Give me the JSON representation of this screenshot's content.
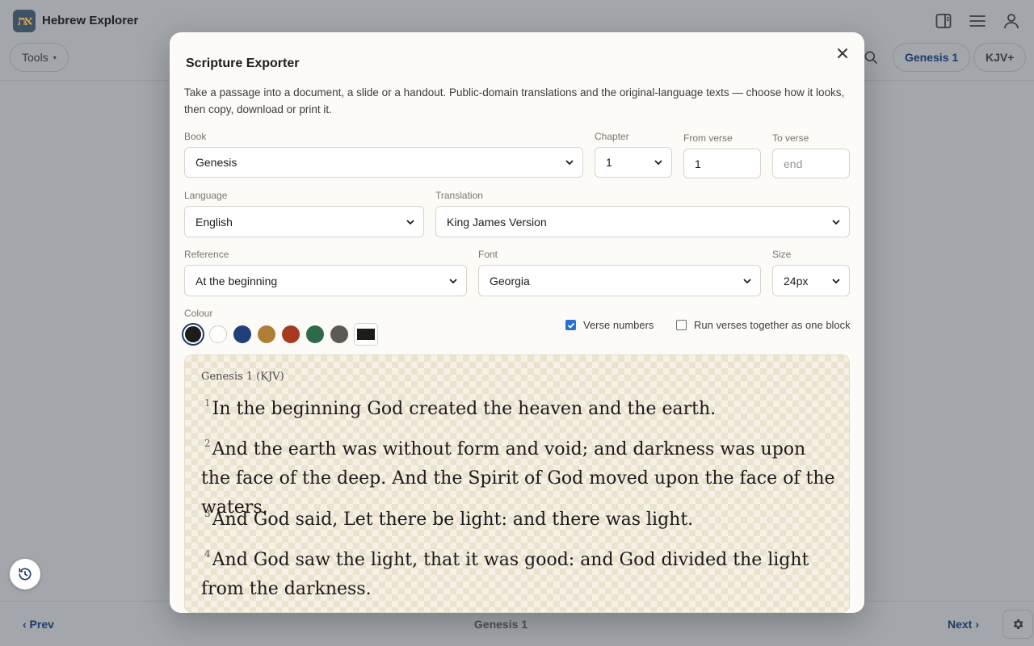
{
  "app": {
    "logo_text": "את",
    "title": "Hebrew Explorer",
    "tools_label": "Tools",
    "book_pill": "Genesis 1",
    "translation_pill": "KJV+"
  },
  "footer": {
    "prev_label": "‹ Prev",
    "title": "Genesis 1",
    "next_label": "Next ›"
  },
  "modal": {
    "title": "Scripture Exporter",
    "intro": "Take a passage into a document, a slide or a handout. Public-domain translations and the original-language texts — choose how it looks, then copy, download or print it.",
    "fields": {
      "book": {
        "label": "Book",
        "value": "Genesis"
      },
      "chapter": {
        "label": "Chapter",
        "value": "1"
      },
      "from_verse": {
        "label": "From verse",
        "value": "1"
      },
      "to_verse": {
        "label": "To verse",
        "value": "",
        "placeholder": "end"
      },
      "language": {
        "label": "Language",
        "value": "English"
      },
      "translation": {
        "label": "Translation",
        "value": "King James Version"
      },
      "reference": {
        "label": "Reference",
        "value": "At the beginning"
      },
      "font": {
        "label": "Font",
        "value": "Georgia"
      },
      "size": {
        "label": "Size",
        "value": "24px"
      }
    },
    "colour": {
      "label": "Colour",
      "swatches": [
        "#1c1c1c",
        "#ffffff",
        "#213f7a",
        "#b07d35",
        "#a63b22",
        "#2e6a4a",
        "#5d5a55"
      ],
      "selected_index": 0
    },
    "options": {
      "verse_numbers": {
        "label": "Verse numbers",
        "checked": true
      },
      "run_together": {
        "label": "Run verses together as one block",
        "checked": false
      }
    },
    "preview": {
      "reference": "Genesis 1 (KJV)",
      "verses": [
        {
          "num": "1",
          "text": "In the beginning God created the heaven and the earth."
        },
        {
          "num": "2",
          "text": "And the earth was without form and void; and darkness was upon the face of the deep. And the Spirit of God moved upon the face of the waters."
        },
        {
          "num": "3",
          "text": "And God said, Let there be light: and there was light."
        },
        {
          "num": "4",
          "text": "And God saw the light, that it was good: and God divided the light from the darkness."
        }
      ]
    }
  }
}
